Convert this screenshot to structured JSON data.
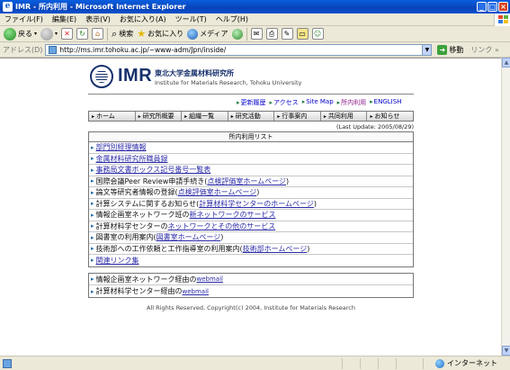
{
  "window": {
    "title": "IMR - 所内利用 - Microsoft Internet Explorer",
    "icon": "ie-icon"
  },
  "menu": [
    "ファイル(F)",
    "編集(E)",
    "表示(V)",
    "お気に入り(A)",
    "ツール(T)",
    "ヘルプ(H)"
  ],
  "toolbar": {
    "back": "戻る",
    "search": "検索",
    "favorites": "お気に入り",
    "media": "メディア"
  },
  "address": {
    "label": "アドレス(D)",
    "url": "http://ms.imr.tohoku.ac.jp/~www-adm/Jpn/inside/",
    "go": "移動",
    "links": "リンク"
  },
  "site": {
    "logo_text": "IMR",
    "org_jp": "東北大学金属材料研究所",
    "org_en": "Institute for Materials Research, Tohoku University",
    "toplinks": [
      "更新履歴",
      "アクセス",
      "Site Map",
      "所内利用",
      "ENGLISH"
    ],
    "nav": [
      "ホーム",
      "研究所概要",
      "組織一覧",
      "研究活動",
      "行事案内",
      "共同利用",
      "お知らせ"
    ],
    "last_update": "(Last Update: 2005/08/29)",
    "list_title": "所内利用リスト",
    "list": [
      {
        "pre": "",
        "link": "部門別経理情報",
        "post": ""
      },
      {
        "pre": "",
        "link": "金属材料研究所職員録",
        "post": ""
      },
      {
        "pre": "",
        "link": "事務局文書ボックス記号番号一覧表",
        "post": ""
      },
      {
        "pre": "国際会議Peer Review申請手続き(",
        "link": "点検評価室ホームページ",
        "post": ")"
      },
      {
        "pre": "論文等研究者情報の登録(",
        "link": "点検評価室ホームページ",
        "post": ")"
      },
      {
        "pre": "計算システムに関するお知らせ(",
        "link": "計算材料学センターのホームページ",
        "post": ")"
      },
      {
        "pre": "情報企画室ネットワーク班の",
        "link": "新ネットワークのサービス",
        "post": ""
      },
      {
        "pre": "計算材料学センターの",
        "link": "ネットワークとその他のサービス",
        "post": ""
      },
      {
        "pre": "図書室の利用案内(",
        "link": "図書室ホームページ",
        "post": ")"
      },
      {
        "pre": "技術部への工作依頼と工作指導室の利用案内(",
        "link": "技術部ホームページ",
        "post": ")"
      },
      {
        "pre": "",
        "link": "関連リンク集",
        "post": ""
      }
    ],
    "webmail": [
      {
        "pre": "情報企画室ネットワーク経由の",
        "link": "webmail"
      },
      {
        "pre": "計算材料学センター経由の",
        "link": "webmail"
      }
    ],
    "footer": "All Rights Reserved, Copyright(c) 2004, Institute for Materials Research"
  },
  "status": {
    "zone": "インターネット"
  }
}
